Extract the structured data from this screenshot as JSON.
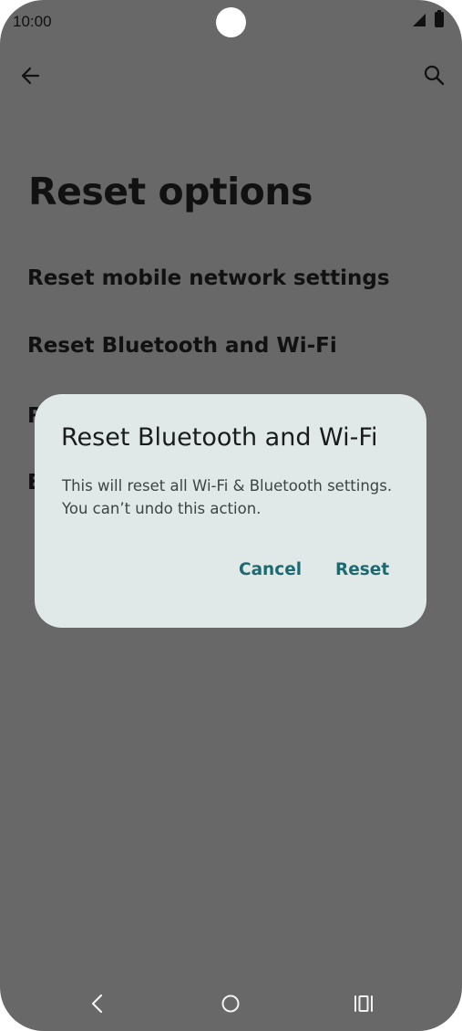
{
  "status_bar": {
    "time": "10:00",
    "icons": [
      "camera-cutout",
      "signal-icon",
      "battery-icon"
    ]
  },
  "toolbar": {
    "back_icon": "arrow-left-icon",
    "search_icon": "search-icon"
  },
  "page": {
    "title": "Reset options",
    "options": [
      "Reset mobile network settings",
      "Reset Bluetooth and Wi-Fi",
      "R",
      "E"
    ]
  },
  "dialog": {
    "title": "Reset Bluetooth and Wi-Fi",
    "body_line1": "This will reset all Wi-Fi & Bluetooth settings.",
    "body_line2": "You can’t undo this action.",
    "cancel_label": "Cancel",
    "confirm_label": "Reset"
  },
  "nav_bar": {
    "icons": [
      "back-chevron-icon",
      "home-circle-icon",
      "recents-icon"
    ]
  },
  "colors": {
    "scrim_background": "#686868",
    "dialog_background": "#e1e8e8",
    "accent": "#1d6b72"
  }
}
